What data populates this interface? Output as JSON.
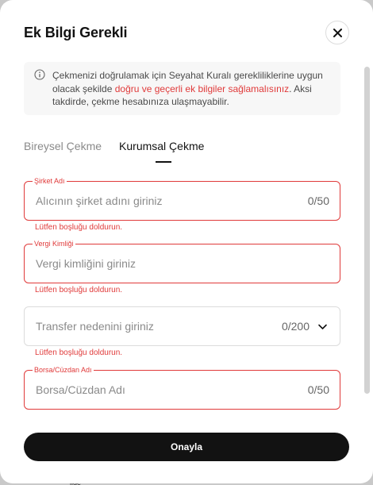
{
  "modal": {
    "title": "Ek Bilgi Gerekli",
    "confirm_label": "Onayla"
  },
  "notice": {
    "text_before": "Çekmenizi doğrulamak için Seyahat Kuralı gerekliliklerine uygun olacak şekilde ",
    "highlight": "doğru ve geçerli ek bilgiler sağlamalısınız",
    "text_after": ". Aksi takdirde, çekme hesabınıza ulaşmayabilir."
  },
  "tabs": [
    {
      "label": "Bireysel Çekme",
      "active": false
    },
    {
      "label": "Kurumsal Çekme",
      "active": true
    }
  ],
  "fields": {
    "company": {
      "label": "Şirket Adı",
      "placeholder": "Alıcının şirket adını giriniz",
      "counter": "0/50",
      "error": "Lütfen boşluğu doldurun."
    },
    "tax_id": {
      "label": "Vergi Kimliği",
      "placeholder": "Vergi kimliğini giriniz",
      "error": "Lütfen boşluğu doldurun."
    },
    "transfer_reason": {
      "placeholder": "Transfer nedenini giriniz",
      "counter": "0/200",
      "error": "Lütfen boşluğu doldurun."
    },
    "exchange_wallet": {
      "label": "Borsa/Cüzdan Adı",
      "placeholder": "Borsa/Cüzdan Adı",
      "counter": "0/50"
    }
  },
  "background": {
    "partial_text": "ilde"
  },
  "colors": {
    "error": "#e03a3a",
    "primary_button": "#121212",
    "notice_bg": "#f7f7f7"
  }
}
